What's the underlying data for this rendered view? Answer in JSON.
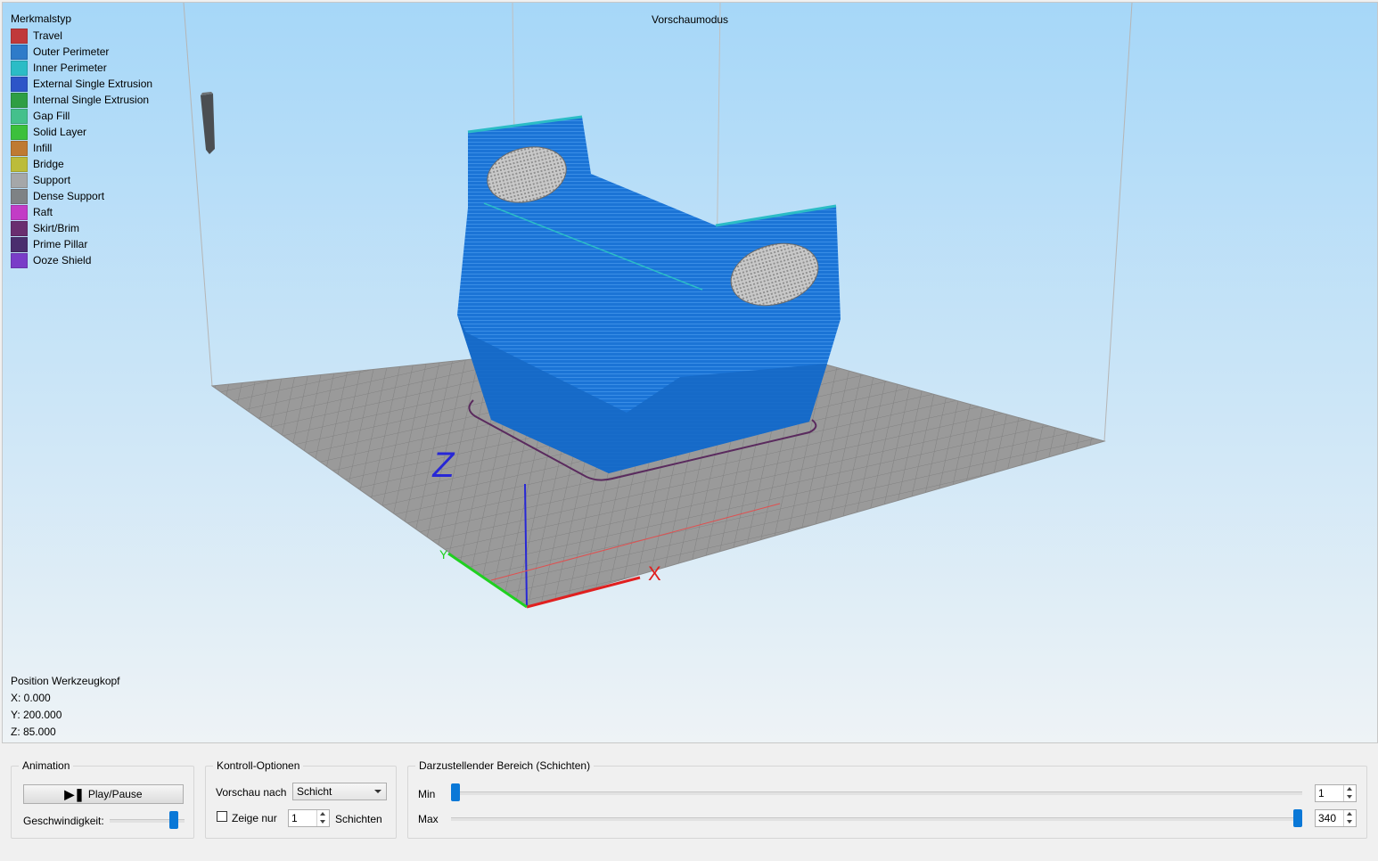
{
  "viewport": {
    "mode_label": "Vorschaumodus",
    "legend": {
      "title": "Merkmalstyp",
      "items": [
        {
          "label": "Travel",
          "color": "#c0393b"
        },
        {
          "label": "Outer Perimeter",
          "color": "#2e7bc9"
        },
        {
          "label": "Inner Perimeter",
          "color": "#2bbcc6"
        },
        {
          "label": "External Single Extrusion",
          "color": "#2d55c8"
        },
        {
          "label": "Internal Single Extrusion",
          "color": "#2e9e44"
        },
        {
          "label": "Gap Fill",
          "color": "#44c08c"
        },
        {
          "label": "Solid Layer",
          "color": "#3cc03c"
        },
        {
          "label": "Infill",
          "color": "#bf7a32"
        },
        {
          "label": "Bridge",
          "color": "#bcbc3a"
        },
        {
          "label": "Support",
          "color": "#a5a7a9"
        },
        {
          "label": "Dense Support",
          "color": "#7e8285"
        },
        {
          "label": "Raft",
          "color": "#c23cc6"
        },
        {
          "label": "Skirt/Brim",
          "color": "#6a2e70"
        },
        {
          "label": "Prime Pillar",
          "color": "#4a2e6e"
        },
        {
          "label": "Ooze Shield",
          "color": "#7a3cc8"
        }
      ]
    },
    "axis_labels": {
      "z": "Z",
      "x": "X"
    },
    "tool_position": {
      "title": "Position Werkzeugkopf",
      "x": "X: 0.000",
      "y": "Y: 200.000",
      "z": "Z: 85.000"
    },
    "colors": {
      "model": "#1b74d6",
      "bed": "#9a9a9a",
      "skirt": "#5a2a5e"
    }
  },
  "panel": {
    "animation": {
      "title": "Animation",
      "play_label": "Play/Pause",
      "speed_label": "Geschwindigkeit:",
      "speed_value": 0.9
    },
    "control": {
      "title": "Kontroll-Optionen",
      "preview_by_label": "Vorschau nach",
      "preview_by_value": "Schicht",
      "show_only_label": "Zeige nur",
      "show_only_value": "1",
      "layers_label": "Schichten"
    },
    "range": {
      "title": "Darzustellender Bereich (Schichten)",
      "min_label": "Min",
      "min_value": "1",
      "max_label": "Max",
      "max_value": "340"
    }
  }
}
